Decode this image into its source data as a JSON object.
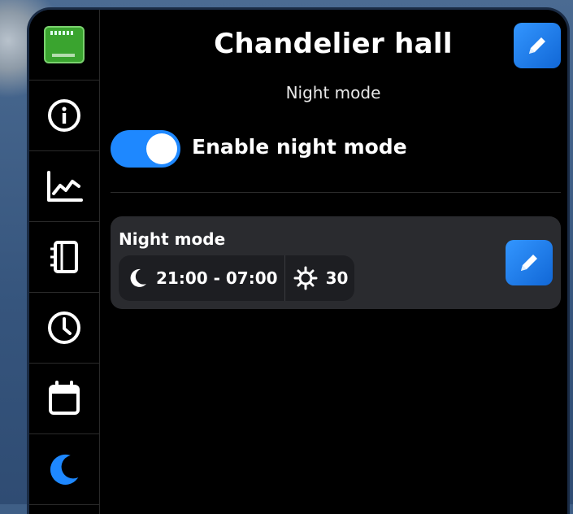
{
  "header": {
    "title": "Chandelier hall",
    "subtitle": "Night mode"
  },
  "toggle": {
    "label": "Enable night mode",
    "enabled": true,
    "color": "#1e88ff"
  },
  "card": {
    "title": "Night mode",
    "time_range": "21:00 - 07:00",
    "brightness": "30"
  },
  "sidebar": {
    "items": [
      {
        "icon": "device-thumbnail"
      },
      {
        "icon": "info-icon"
      },
      {
        "icon": "chart-icon"
      },
      {
        "icon": "notebook-icon"
      },
      {
        "icon": "clock-icon"
      },
      {
        "icon": "calendar-icon"
      },
      {
        "icon": "moon-icon",
        "active": true
      }
    ]
  }
}
